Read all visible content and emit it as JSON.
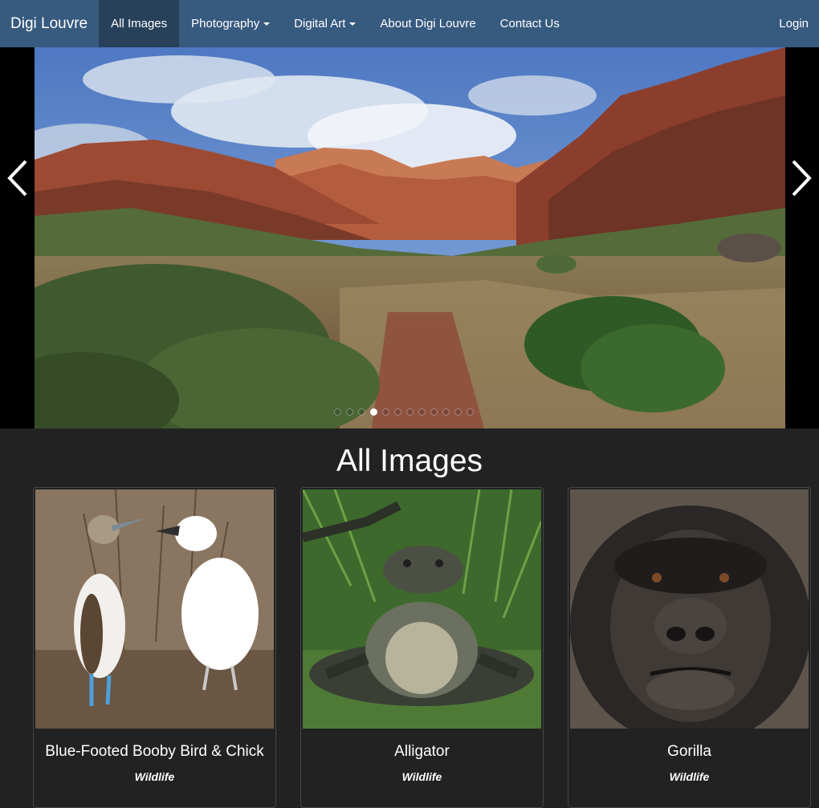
{
  "nav": {
    "brand": "Digi Louvre",
    "items": [
      {
        "label": "All Images",
        "active": true,
        "dropdown": false
      },
      {
        "label": "Photography",
        "active": false,
        "dropdown": true
      },
      {
        "label": "Digital Art",
        "active": false,
        "dropdown": true
      },
      {
        "label": "About Digi Louvre",
        "active": false,
        "dropdown": false
      },
      {
        "label": "Contact Us",
        "active": false,
        "dropdown": false
      }
    ],
    "login": "Login"
  },
  "carousel": {
    "slide_count": 12,
    "active_index": 3,
    "prev_icon": "chevron-left-icon",
    "next_icon": "chevron-right-icon"
  },
  "section": {
    "title": "All Images"
  },
  "cards": [
    {
      "title": "Blue-Footed Booby Bird & Chick",
      "category": "Wildlife"
    },
    {
      "title": "Alligator",
      "category": "Wildlife"
    },
    {
      "title": "Gorilla",
      "category": "Wildlife"
    }
  ],
  "colors": {
    "navbar": "#375a7f",
    "navbar_active": "#28415b",
    "page_background": "#222222"
  }
}
